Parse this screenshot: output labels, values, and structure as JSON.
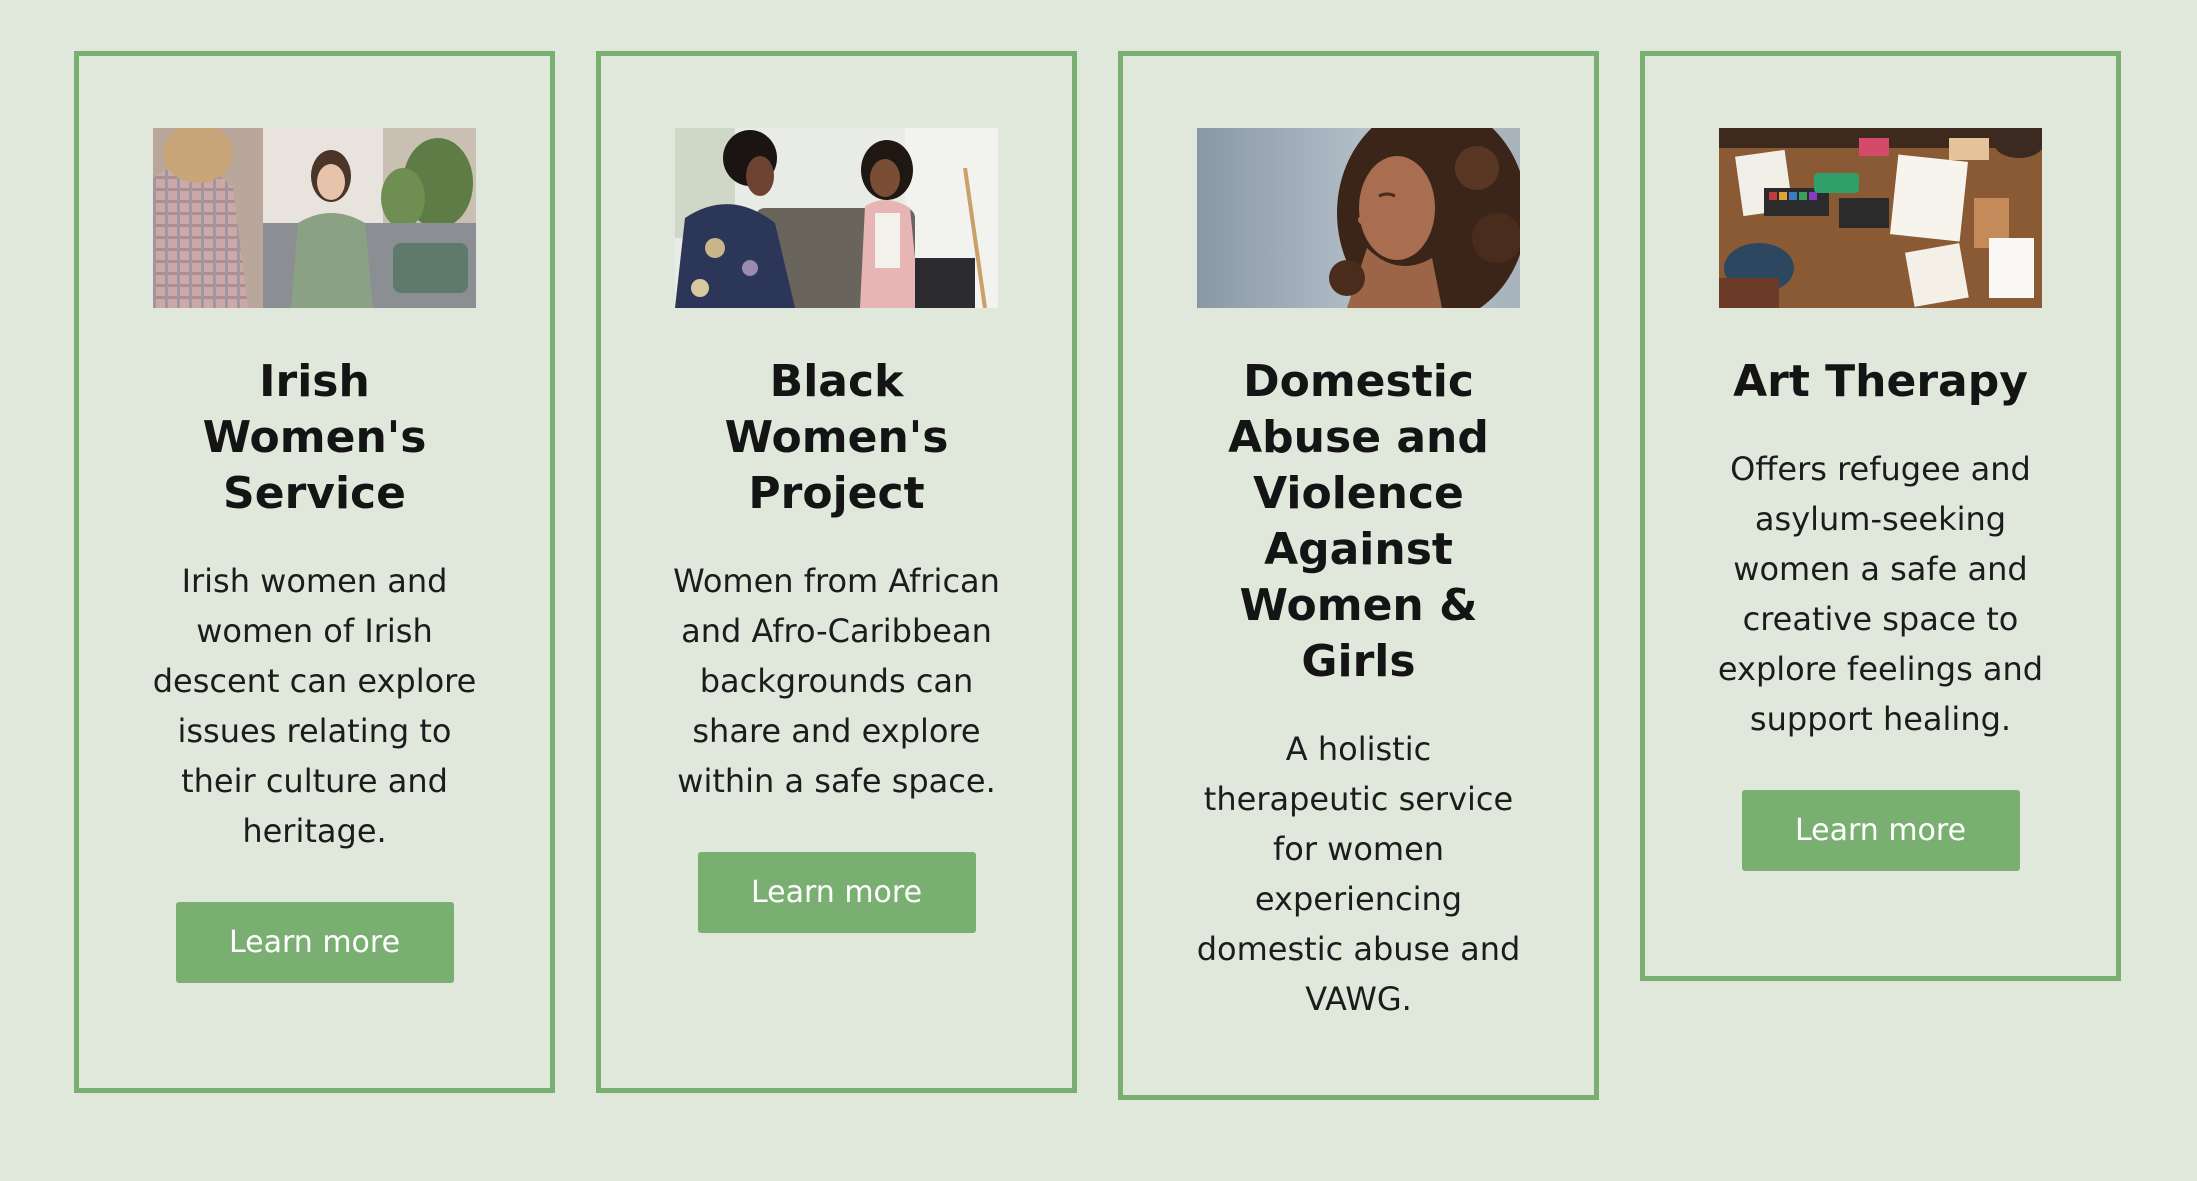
{
  "colors": {
    "background": "#dfe8db",
    "accent": "#7aaf72",
    "button_text": "#ffffff"
  },
  "cards": [
    {
      "title": "Irish Women's Service",
      "description": "Irish women and women of Irish descent can explore issues relating to their culture and heritage.",
      "button_label": "Learn more"
    },
    {
      "title": "Black Women's Project",
      "description": "Women from African and Afro-Caribbean backgrounds can share and explore within a safe space.",
      "button_label": "Learn more"
    },
    {
      "title": "Domestic Abuse and Violence Against Women & Girls",
      "description": "A holistic therapeutic service for women experiencing domestic abuse and VAWG."
    },
    {
      "title": "Art Therapy",
      "description": "Offers refugee and asylum-seeking women a safe and creative space to explore feelings and support healing.",
      "button_label": "Learn more"
    }
  ]
}
